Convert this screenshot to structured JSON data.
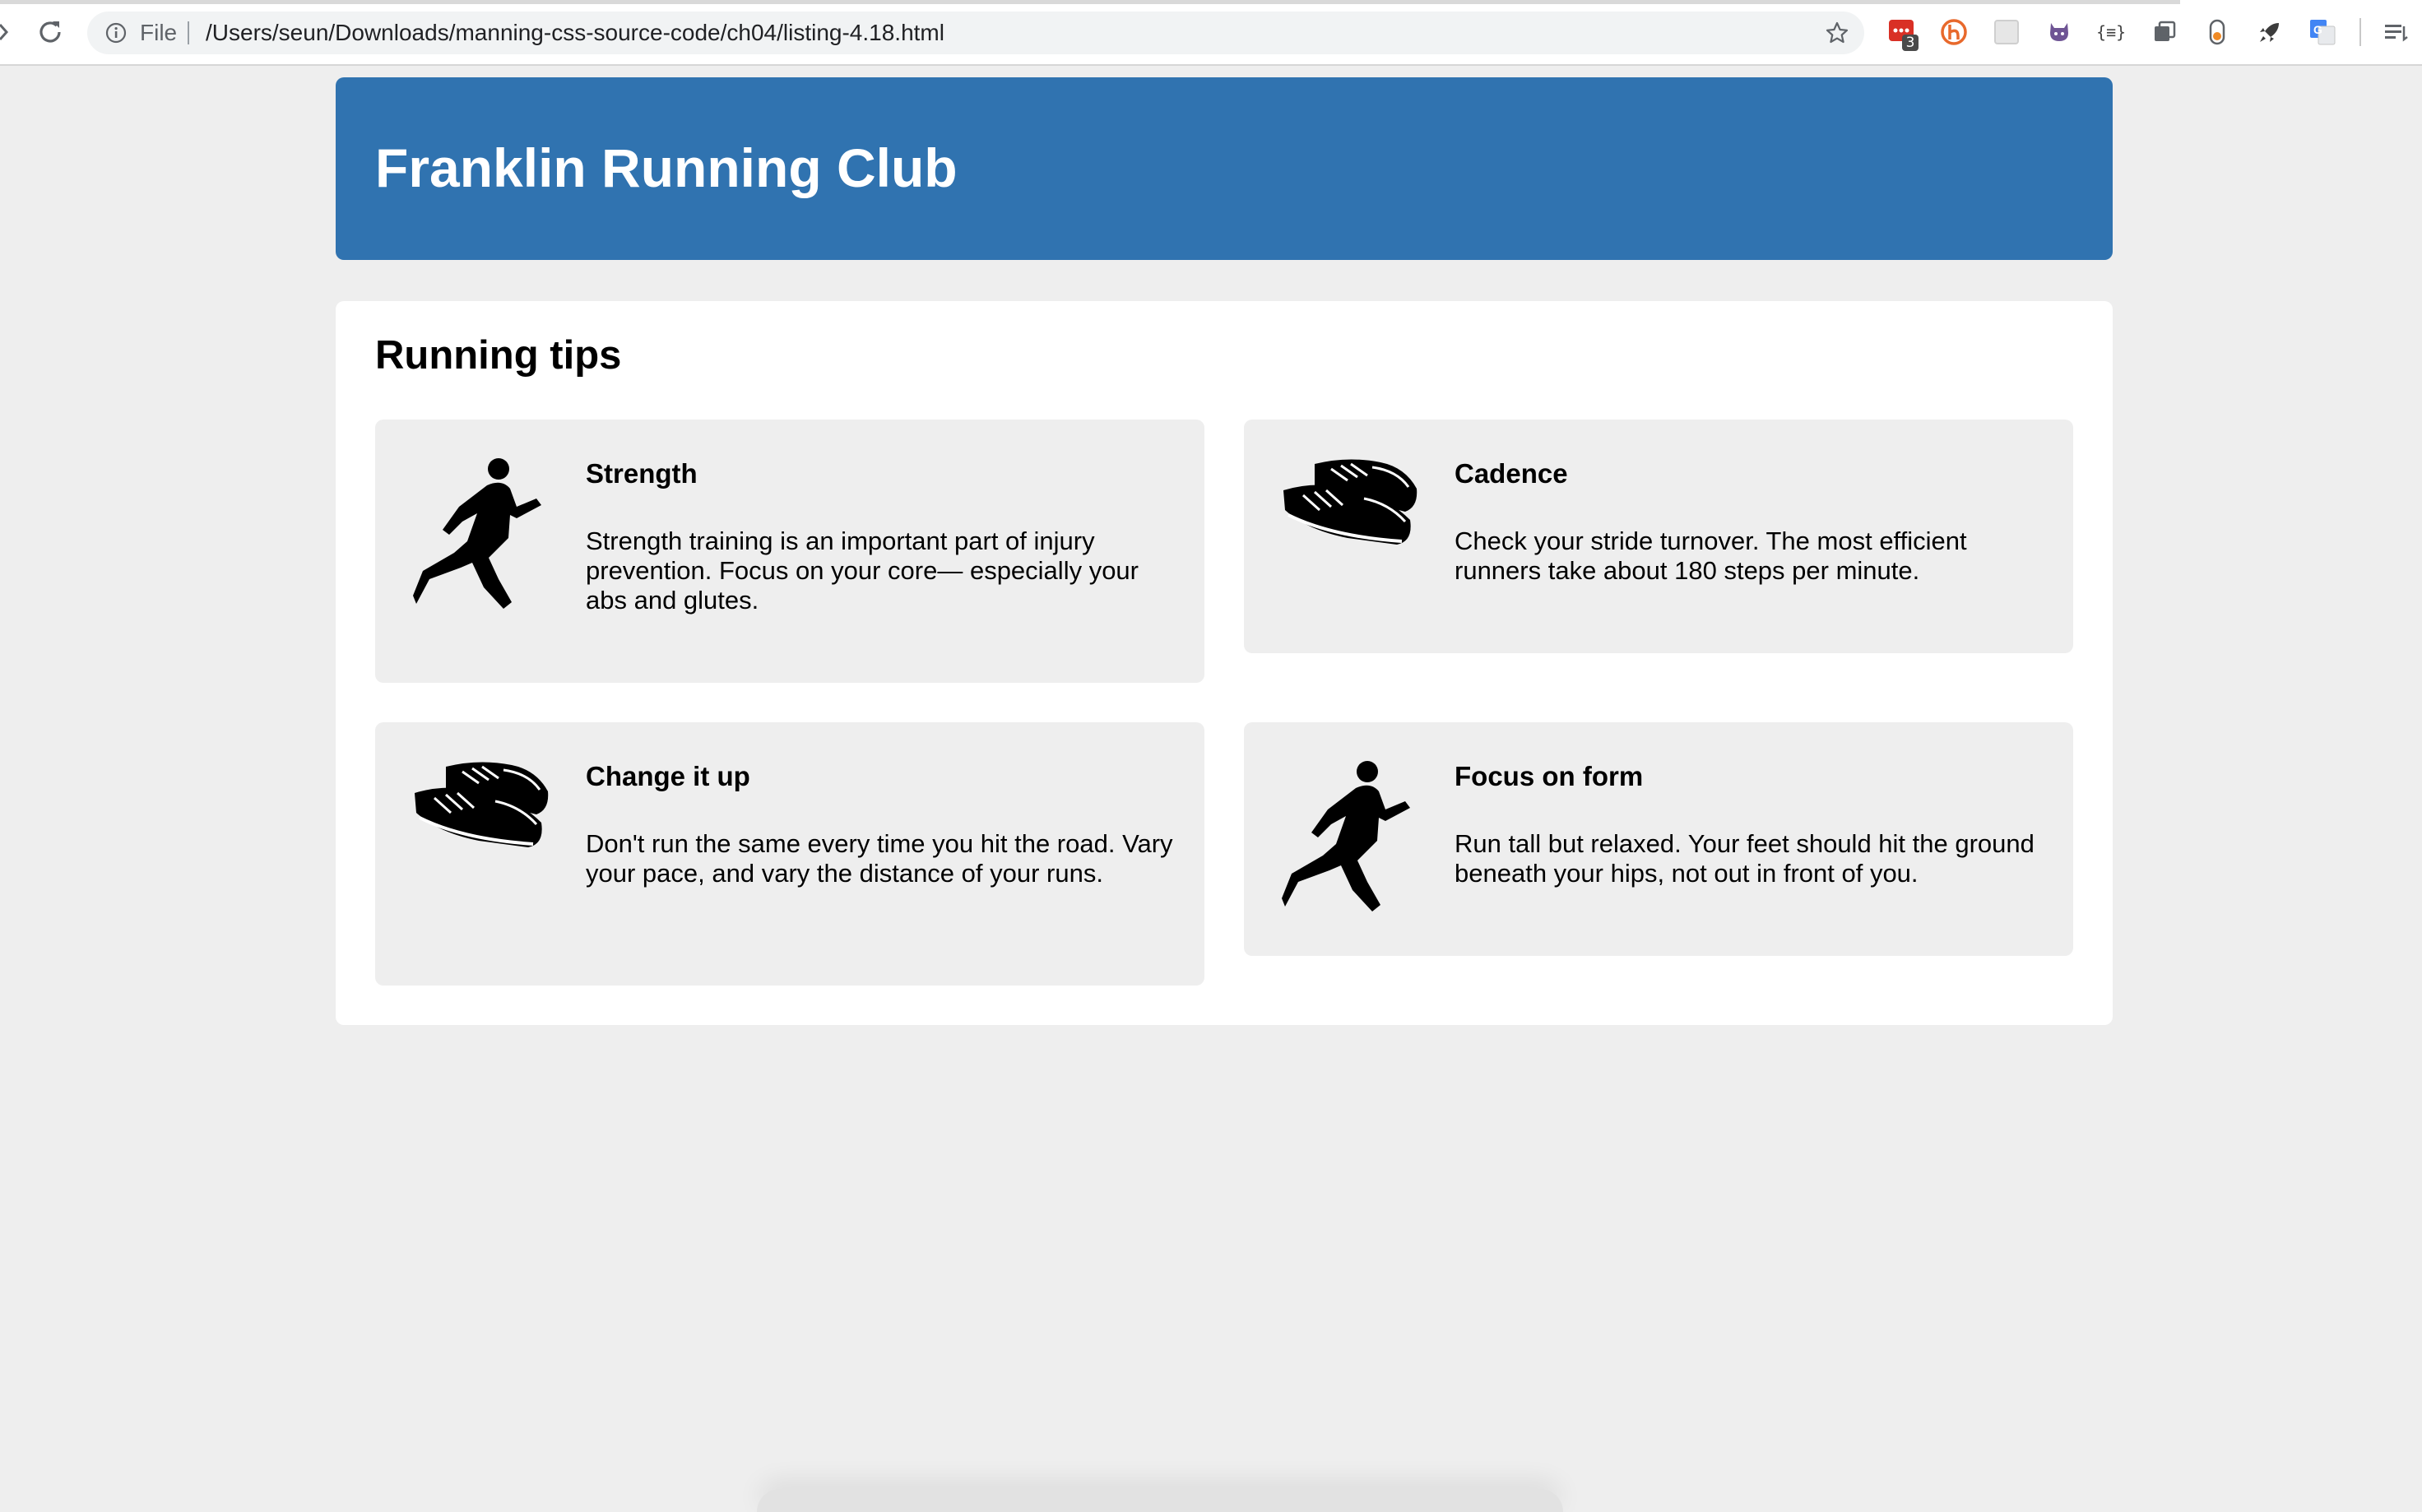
{
  "browser": {
    "scheme_label": "File",
    "url": "/Users/seun/Downloads/manning-css-source-code/ch04/listing-4.18.html",
    "extension_badge": "3",
    "extensions": [
      "todoist-icon",
      "honey-icon",
      "blank-extension-icon",
      "octotree-icon",
      "json-viewer-icon",
      "tab-manager-icon",
      "toggle-icon",
      "rocket-icon",
      "google-translate-icon",
      "reading-list-icon"
    ],
    "colors": {
      "toolbar": "#ffffff",
      "omnibox": "#f1f3f4"
    }
  },
  "header": {
    "title": "Franklin Running Club",
    "background": "#3073b0"
  },
  "main": {
    "title": "Running tips",
    "tiles": [
      {
        "title": "Strength",
        "icon": "runner-icon",
        "body": "Strength training is an important part of injury prevention. Focus on your core— especially your abs and glutes."
      },
      {
        "title": "Cadence",
        "icon": "shoes-icon",
        "body": "Check your stride turnover. The most efficient runners take about 180 steps per minute."
      },
      {
        "title": "Change it up",
        "icon": "shoes-icon",
        "body": "Don't run the same every time you hit the road. Vary your pace, and vary the distance of your runs."
      },
      {
        "title": "Focus on form",
        "icon": "runner-icon",
        "body": "Run tall but relaxed. Your feet should hit the ground beneath your hips, not out in front of you."
      }
    ]
  },
  "colors": {
    "page_background": "#eeeeee",
    "panel_background": "#ffffff",
    "tile_background": "#eeeeee"
  }
}
